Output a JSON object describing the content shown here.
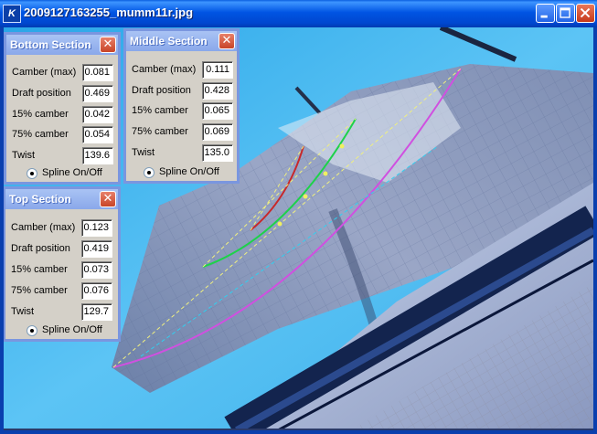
{
  "window": {
    "title": "2009127163255_mumm11r.jpg",
    "app_icon_text": "K"
  },
  "panels": {
    "bottom": {
      "title": "Bottom Section",
      "close": "✕",
      "spline": "Spline On/Off",
      "rows": [
        {
          "label": "Camber (max)",
          "value": "0.081"
        },
        {
          "label": "Draft position",
          "value": "0.469"
        },
        {
          "label": "15% camber",
          "value": "0.042"
        },
        {
          "label": "75% camber",
          "value": "0.054"
        },
        {
          "label": "Twist",
          "value": "139.6"
        }
      ]
    },
    "middle": {
      "title": "Middle Section",
      "close": "✕",
      "spline": "Spline On/Off",
      "rows": [
        {
          "label": "Camber (max)",
          "value": "0.111"
        },
        {
          "label": "Draft position",
          "value": "0.428"
        },
        {
          "label": "15% camber",
          "value": "0.065"
        },
        {
          "label": "75% camber",
          "value": "0.069"
        },
        {
          "label": "Twist",
          "value": "135.0"
        }
      ]
    },
    "top": {
      "title": "Top Section",
      "close": "✕",
      "spline": "Spline On/Off",
      "rows": [
        {
          "label": "Camber (max)",
          "value": "0.123"
        },
        {
          "label": "Draft position",
          "value": "0.419"
        },
        {
          "label": "15% camber",
          "value": "0.073"
        },
        {
          "label": "75% camber",
          "value": "0.076"
        },
        {
          "label": "Twist",
          "value": "129.7"
        }
      ]
    }
  }
}
